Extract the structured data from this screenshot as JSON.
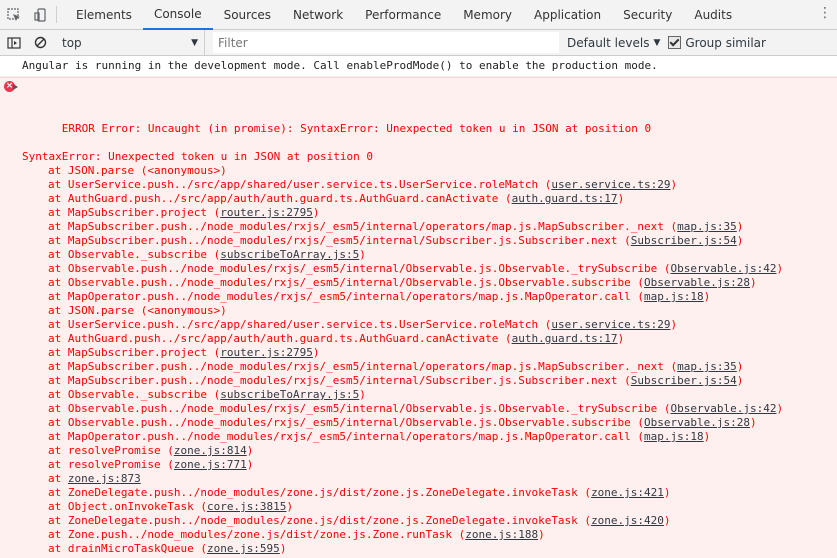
{
  "tabs": [
    "Elements",
    "Console",
    "Sources",
    "Network",
    "Performance",
    "Memory",
    "Application",
    "Security",
    "Audits"
  ],
  "active_tab_index": 1,
  "toolbar": {
    "context": "top",
    "filter_placeholder": "Filter",
    "levels": "Default levels",
    "group_similar": "Group similar",
    "group_similar_checked": true
  },
  "console": {
    "info": "Angular is running in the development mode. Call enableProdMode() to enable the production mode.",
    "error_head": "ERROR Error: Uncaught (in promise): SyntaxError: Unexpected token u in JSON at position 0",
    "error_line": "SyntaxError: Unexpected token u in JSON at position 0",
    "frames": [
      {
        "text": "at JSON.parse (<anonymous>)",
        "src": ""
      },
      {
        "text": "at UserService.push../src/app/shared/user.service.ts.UserService.roleMatch",
        "src": "user.service.ts:29"
      },
      {
        "text": "at AuthGuard.push../src/app/auth/auth.guard.ts.AuthGuard.canActivate",
        "src": "auth.guard.ts:17"
      },
      {
        "text": "at MapSubscriber.project",
        "src": "router.js:2795"
      },
      {
        "text": "at MapSubscriber.push../node_modules/rxjs/_esm5/internal/operators/map.js.MapSubscriber._next",
        "src": "map.js:35"
      },
      {
        "text": "at MapSubscriber.push../node_modules/rxjs/_esm5/internal/Subscriber.js.Subscriber.next",
        "src": "Subscriber.js:54"
      },
      {
        "text": "at Observable._subscribe",
        "src": "subscribeToArray.js:5"
      },
      {
        "text": "at Observable.push../node_modules/rxjs/_esm5/internal/Observable.js.Observable._trySubscribe",
        "src": "Observable.js:42"
      },
      {
        "text": "at Observable.push../node_modules/rxjs/_esm5/internal/Observable.js.Observable.subscribe",
        "src": "Observable.js:28"
      },
      {
        "text": "at MapOperator.push../node_modules/rxjs/_esm5/internal/operators/map.js.MapOperator.call",
        "src": "map.js:18"
      },
      {
        "text": "at JSON.parse (<anonymous>)",
        "src": ""
      },
      {
        "text": "at UserService.push../src/app/shared/user.service.ts.UserService.roleMatch",
        "src": "user.service.ts:29"
      },
      {
        "text": "at AuthGuard.push../src/app/auth/auth.guard.ts.AuthGuard.canActivate",
        "src": "auth.guard.ts:17"
      },
      {
        "text": "at MapSubscriber.project",
        "src": "router.js:2795"
      },
      {
        "text": "at MapSubscriber.push../node_modules/rxjs/_esm5/internal/operators/map.js.MapSubscriber._next",
        "src": "map.js:35"
      },
      {
        "text": "at MapSubscriber.push../node_modules/rxjs/_esm5/internal/Subscriber.js.Subscriber.next",
        "src": "Subscriber.js:54"
      },
      {
        "text": "at Observable._subscribe",
        "src": "subscribeToArray.js:5"
      },
      {
        "text": "at Observable.push../node_modules/rxjs/_esm5/internal/Observable.js.Observable._trySubscribe",
        "src": "Observable.js:42"
      },
      {
        "text": "at Observable.push../node_modules/rxjs/_esm5/internal/Observable.js.Observable.subscribe",
        "src": "Observable.js:28"
      },
      {
        "text": "at MapOperator.push../node_modules/rxjs/_esm5/internal/operators/map.js.MapOperator.call",
        "src": "map.js:18"
      },
      {
        "text": "at resolvePromise",
        "src": "zone.js:814"
      },
      {
        "text": "at resolvePromise",
        "src": "zone.js:771"
      },
      {
        "text": "at ",
        "src": "zone.js:873",
        "bare": true
      },
      {
        "text": "at ZoneDelegate.push../node_modules/zone.js/dist/zone.js.ZoneDelegate.invokeTask",
        "src": "zone.js:421"
      },
      {
        "text": "at Object.onInvokeTask",
        "src": "core.js:3815"
      },
      {
        "text": "at ZoneDelegate.push../node_modules/zone.js/dist/zone.js.ZoneDelegate.invokeTask",
        "src": "zone.js:420"
      },
      {
        "text": "at Zone.push../node_modules/zone.js/dist/zone.js.Zone.runTask",
        "src": "zone.js:188"
      },
      {
        "text": "at drainMicroTaskQueue",
        "src": "zone.js:595"
      }
    ]
  },
  "colors": {
    "error_text": "#ff0000",
    "error_bg": "#fff0f0",
    "active_tab": "#1a73e8"
  }
}
